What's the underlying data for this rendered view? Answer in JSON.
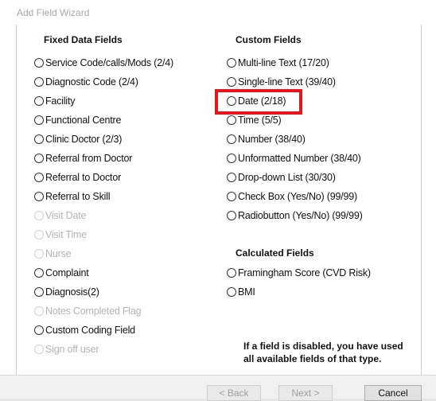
{
  "window": {
    "title": "Add Field Wizard"
  },
  "fixed": {
    "header": "Fixed Data Fields",
    "items": [
      {
        "label": "Service Code/calls/Mods (2/4)",
        "enabled": true
      },
      {
        "label": "Diagnostic Code (2/4)",
        "enabled": true
      },
      {
        "label": "Facility",
        "enabled": true
      },
      {
        "label": "Functional Centre",
        "enabled": true
      },
      {
        "label": "Clinic Doctor (2/3)",
        "enabled": true
      },
      {
        "label": "Referral from Doctor",
        "enabled": true
      },
      {
        "label": "Referral to Doctor",
        "enabled": true
      },
      {
        "label": "Referral to Skill",
        "enabled": true
      },
      {
        "label": "Visit Date",
        "enabled": false
      },
      {
        "label": "Visit Time",
        "enabled": false
      },
      {
        "label": "Nurse",
        "enabled": false
      },
      {
        "label": "Complaint",
        "enabled": true
      },
      {
        "label": "Diagnosis(2)",
        "enabled": true
      },
      {
        "label": "Notes Completed Flag",
        "enabled": false
      },
      {
        "label": "Custom Coding Field",
        "enabled": true
      },
      {
        "label": "Sign off user",
        "enabled": false
      }
    ]
  },
  "custom": {
    "header": "Custom Fields",
    "items": [
      {
        "label": "Multi-line Text (17/20)",
        "enabled": true
      },
      {
        "label": "Single-line Text (39/40)",
        "enabled": true
      },
      {
        "label": "Date (2/18)",
        "enabled": true
      },
      {
        "label": "Time (5/5)",
        "enabled": true
      },
      {
        "label": "Number (38/40)",
        "enabled": true
      },
      {
        "label": "Unformatted Number (38/40)",
        "enabled": true
      },
      {
        "label": "Drop-down List (30/30)",
        "enabled": true
      },
      {
        "label": "Check Box (Yes/No) (99/99)",
        "enabled": true
      },
      {
        "label": "Radiobutton (Yes/No) (99/99)",
        "enabled": true
      }
    ]
  },
  "calculated": {
    "header": "Calculated Fields",
    "items": [
      {
        "label": "Framingham Score (CVD Risk)",
        "enabled": true
      },
      {
        "label": "BMI",
        "enabled": true
      }
    ]
  },
  "note": {
    "line1": "If a field is disabled, you have used",
    "line2": "all available fields of that type."
  },
  "buttons": {
    "back": "< Back",
    "next": "Next >",
    "cancel": "Cancel"
  },
  "colors": {
    "highlight": "#e8141c",
    "disabled_text": "#b4b4b4"
  }
}
